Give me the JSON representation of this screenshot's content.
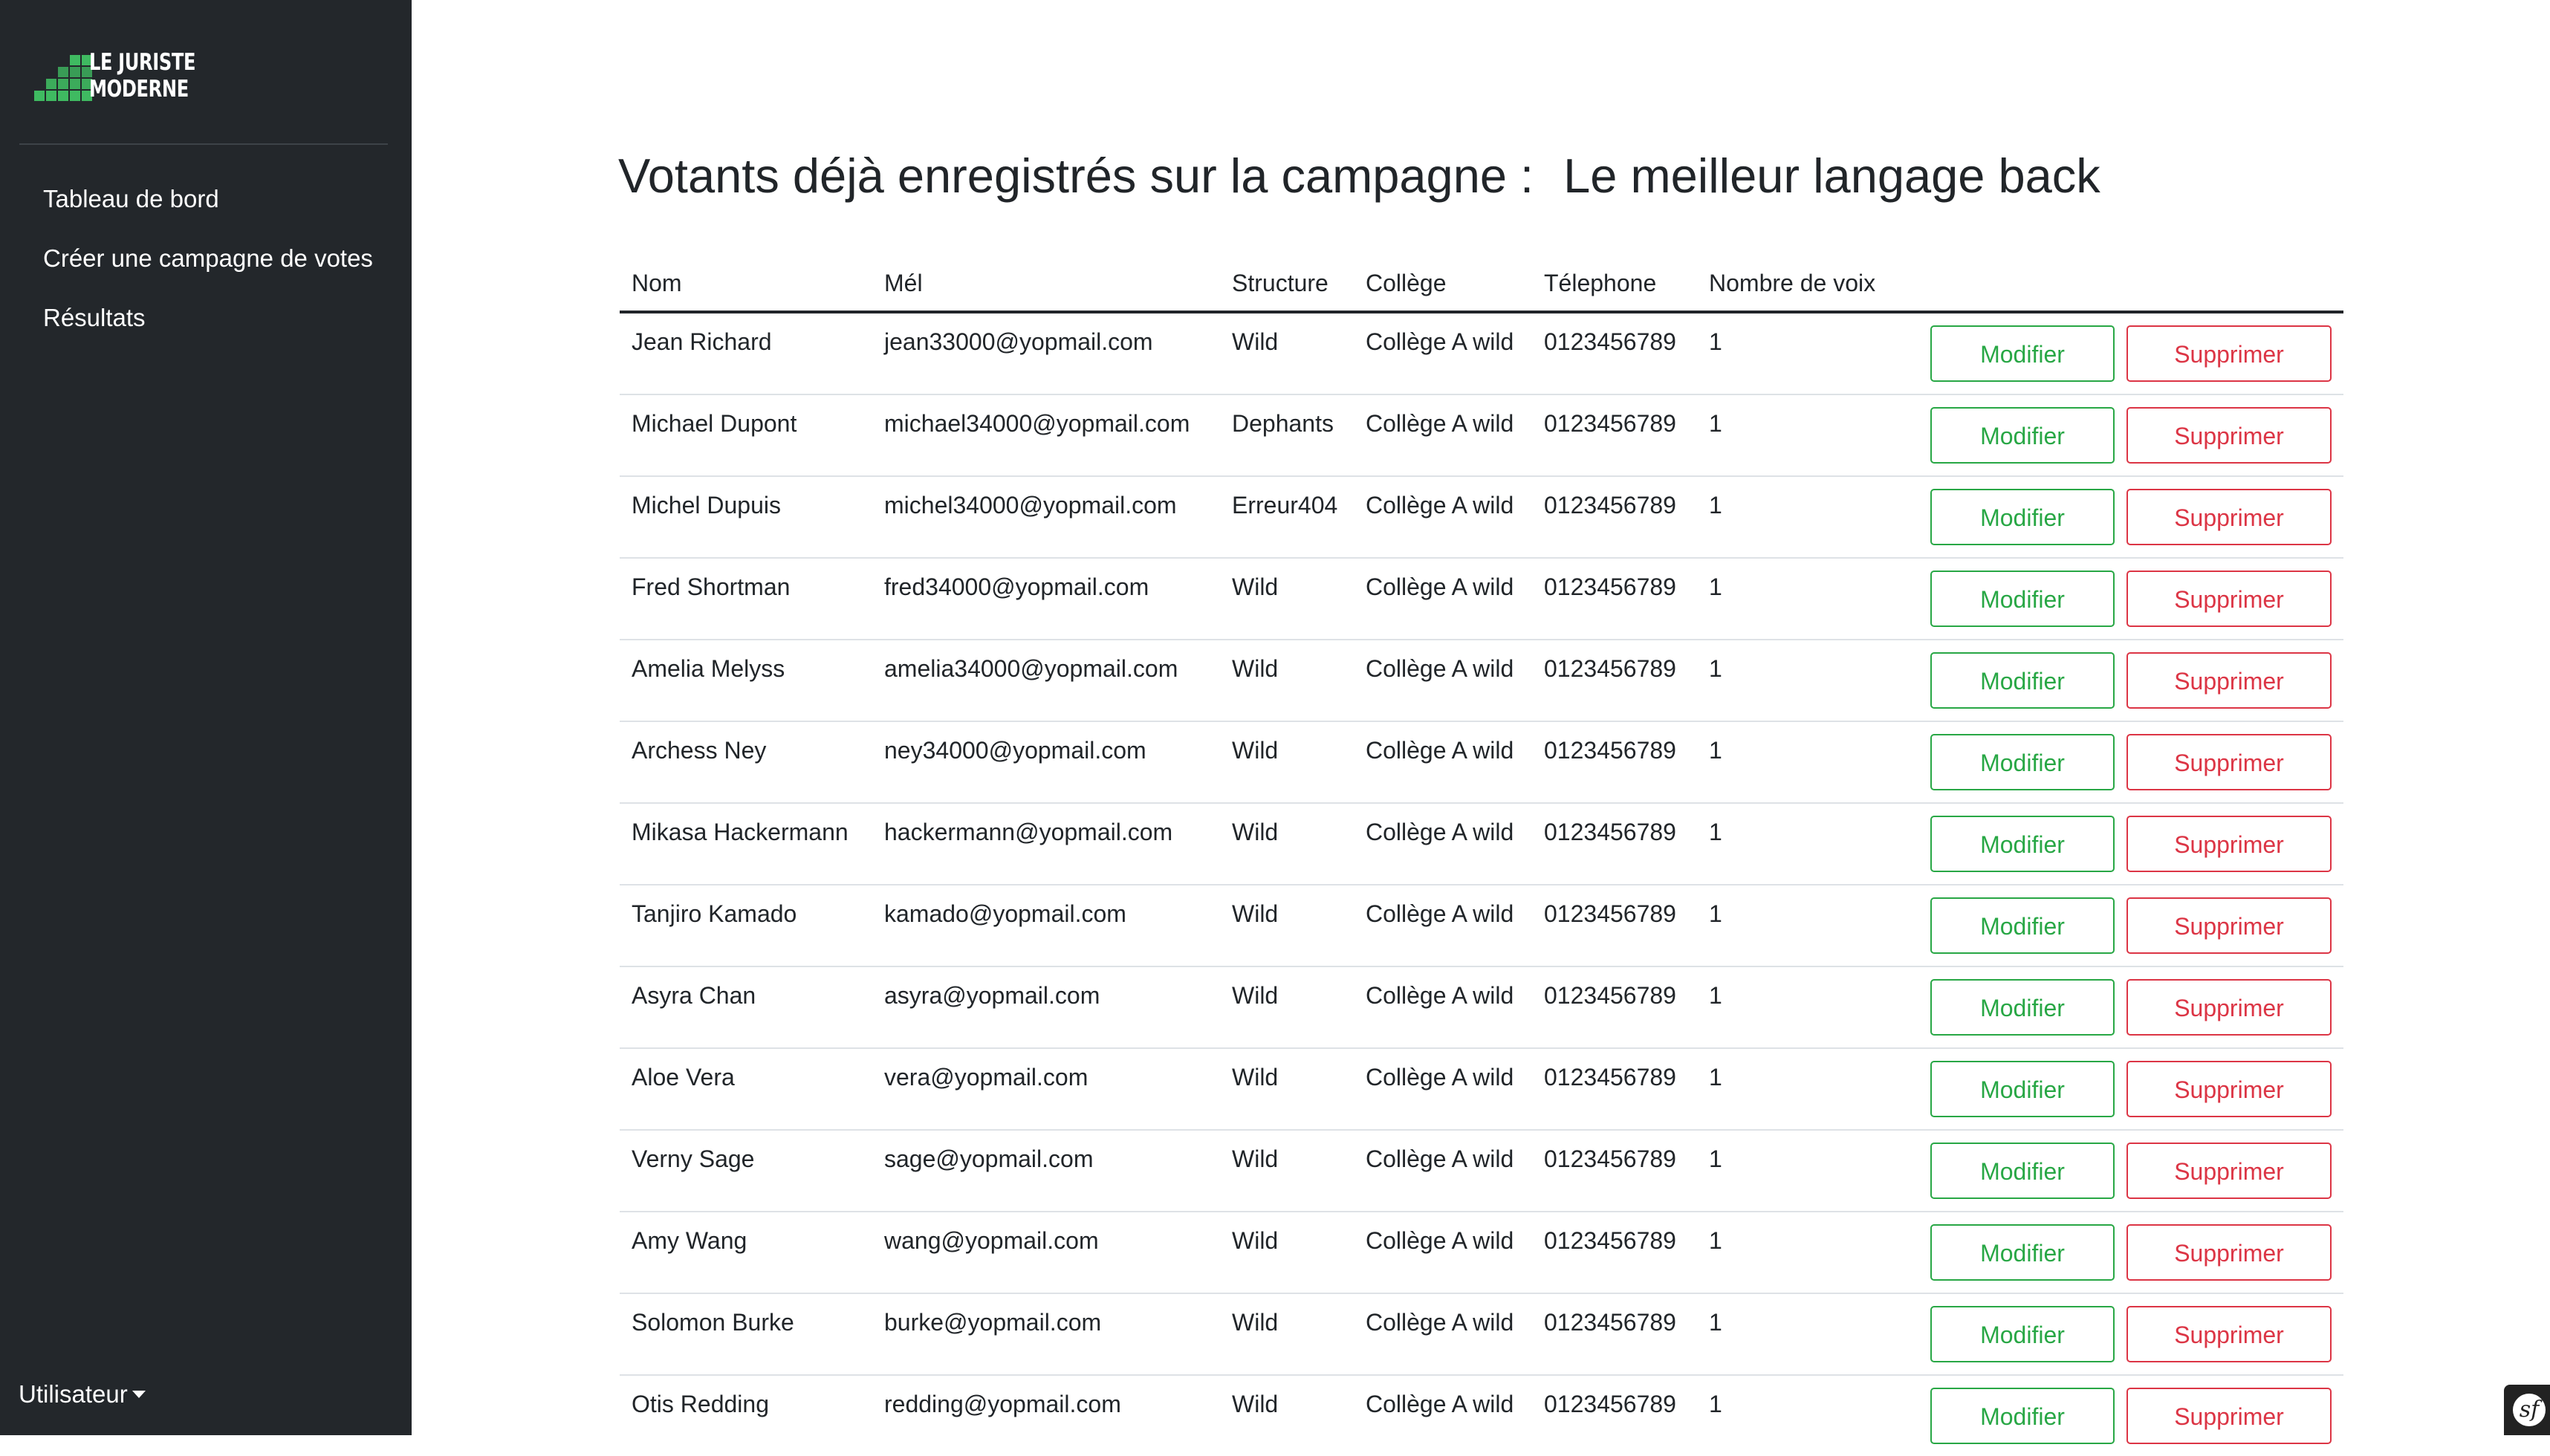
{
  "brand": {
    "line1": "LE JURISTE",
    "line2": "MODERNE",
    "accent_color": "#3fba61"
  },
  "sidebar": {
    "items": [
      {
        "label": "Tableau de bord"
      },
      {
        "label": "Créer une campagne de votes"
      },
      {
        "label": "Résultats"
      }
    ],
    "user_menu": "Utilisateur"
  },
  "page": {
    "title_prefix": "Votants déjà enregistrés sur la campagne :",
    "campaign_name": "Le meilleur langage back"
  },
  "table": {
    "headers": {
      "name": "Nom",
      "email": "Mél",
      "structure": "Structure",
      "college": "Collège",
      "phone": "Télephone",
      "votes": "Nombre de voix"
    },
    "modify_label": "Modifier",
    "delete_label": "Supprimer",
    "rows": [
      {
        "name": "Jean Richard",
        "email": "jean33000@yopmail.com",
        "structure": "Wild",
        "college": "Collège A wild",
        "phone": "0123456789",
        "votes": "1"
      },
      {
        "name": "Michael Dupont",
        "email": "michael34000@yopmail.com",
        "structure": "Dephants",
        "college": "Collège A wild",
        "phone": "0123456789",
        "votes": "1"
      },
      {
        "name": "Michel Dupuis",
        "email": "michel34000@yopmail.com",
        "structure": "Erreur404",
        "college": "Collège A wild",
        "phone": "0123456789",
        "votes": "1"
      },
      {
        "name": "Fred Shortman",
        "email": "fred34000@yopmail.com",
        "structure": "Wild",
        "college": "Collège A wild",
        "phone": "0123456789",
        "votes": "1"
      },
      {
        "name": "Amelia Melyss",
        "email": "amelia34000@yopmail.com",
        "structure": "Wild",
        "college": "Collège A wild",
        "phone": "0123456789",
        "votes": "1"
      },
      {
        "name": "Archess Ney",
        "email": "ney34000@yopmail.com",
        "structure": "Wild",
        "college": "Collège A wild",
        "phone": "0123456789",
        "votes": "1"
      },
      {
        "name": "Mikasa Hackermann",
        "email": "hackermann@yopmail.com",
        "structure": "Wild",
        "college": "Collège A wild",
        "phone": "0123456789",
        "votes": "1"
      },
      {
        "name": "Tanjiro Kamado",
        "email": "kamado@yopmail.com",
        "structure": "Wild",
        "college": "Collège A wild",
        "phone": "0123456789",
        "votes": "1"
      },
      {
        "name": "Asyra Chan",
        "email": "asyra@yopmail.com",
        "structure": "Wild",
        "college": "Collège A wild",
        "phone": "0123456789",
        "votes": "1"
      },
      {
        "name": "Aloe Vera",
        "email": "vera@yopmail.com",
        "structure": "Wild",
        "college": "Collège A wild",
        "phone": "0123456789",
        "votes": "1"
      },
      {
        "name": "Verny Sage",
        "email": "sage@yopmail.com",
        "structure": "Wild",
        "college": "Collège A wild",
        "phone": "0123456789",
        "votes": "1"
      },
      {
        "name": "Amy Wang",
        "email": "wang@yopmail.com",
        "structure": "Wild",
        "college": "Collège A wild",
        "phone": "0123456789",
        "votes": "1"
      },
      {
        "name": "Solomon Burke",
        "email": "burke@yopmail.com",
        "structure": "Wild",
        "college": "Collège A wild",
        "phone": "0123456789",
        "votes": "1"
      },
      {
        "name": "Otis Redding",
        "email": "redding@yopmail.com",
        "structure": "Wild",
        "college": "Collège A wild",
        "phone": "0123456789",
        "votes": "1"
      }
    ]
  },
  "colors": {
    "sidebar_bg": "#23272b",
    "modify": "#28a745",
    "delete": "#dc3545"
  },
  "icons": {
    "brand_logo": "stepped-green-squares-logo",
    "user_caret": "caret-down-icon",
    "debug_toolbar": "symfony-icon"
  }
}
